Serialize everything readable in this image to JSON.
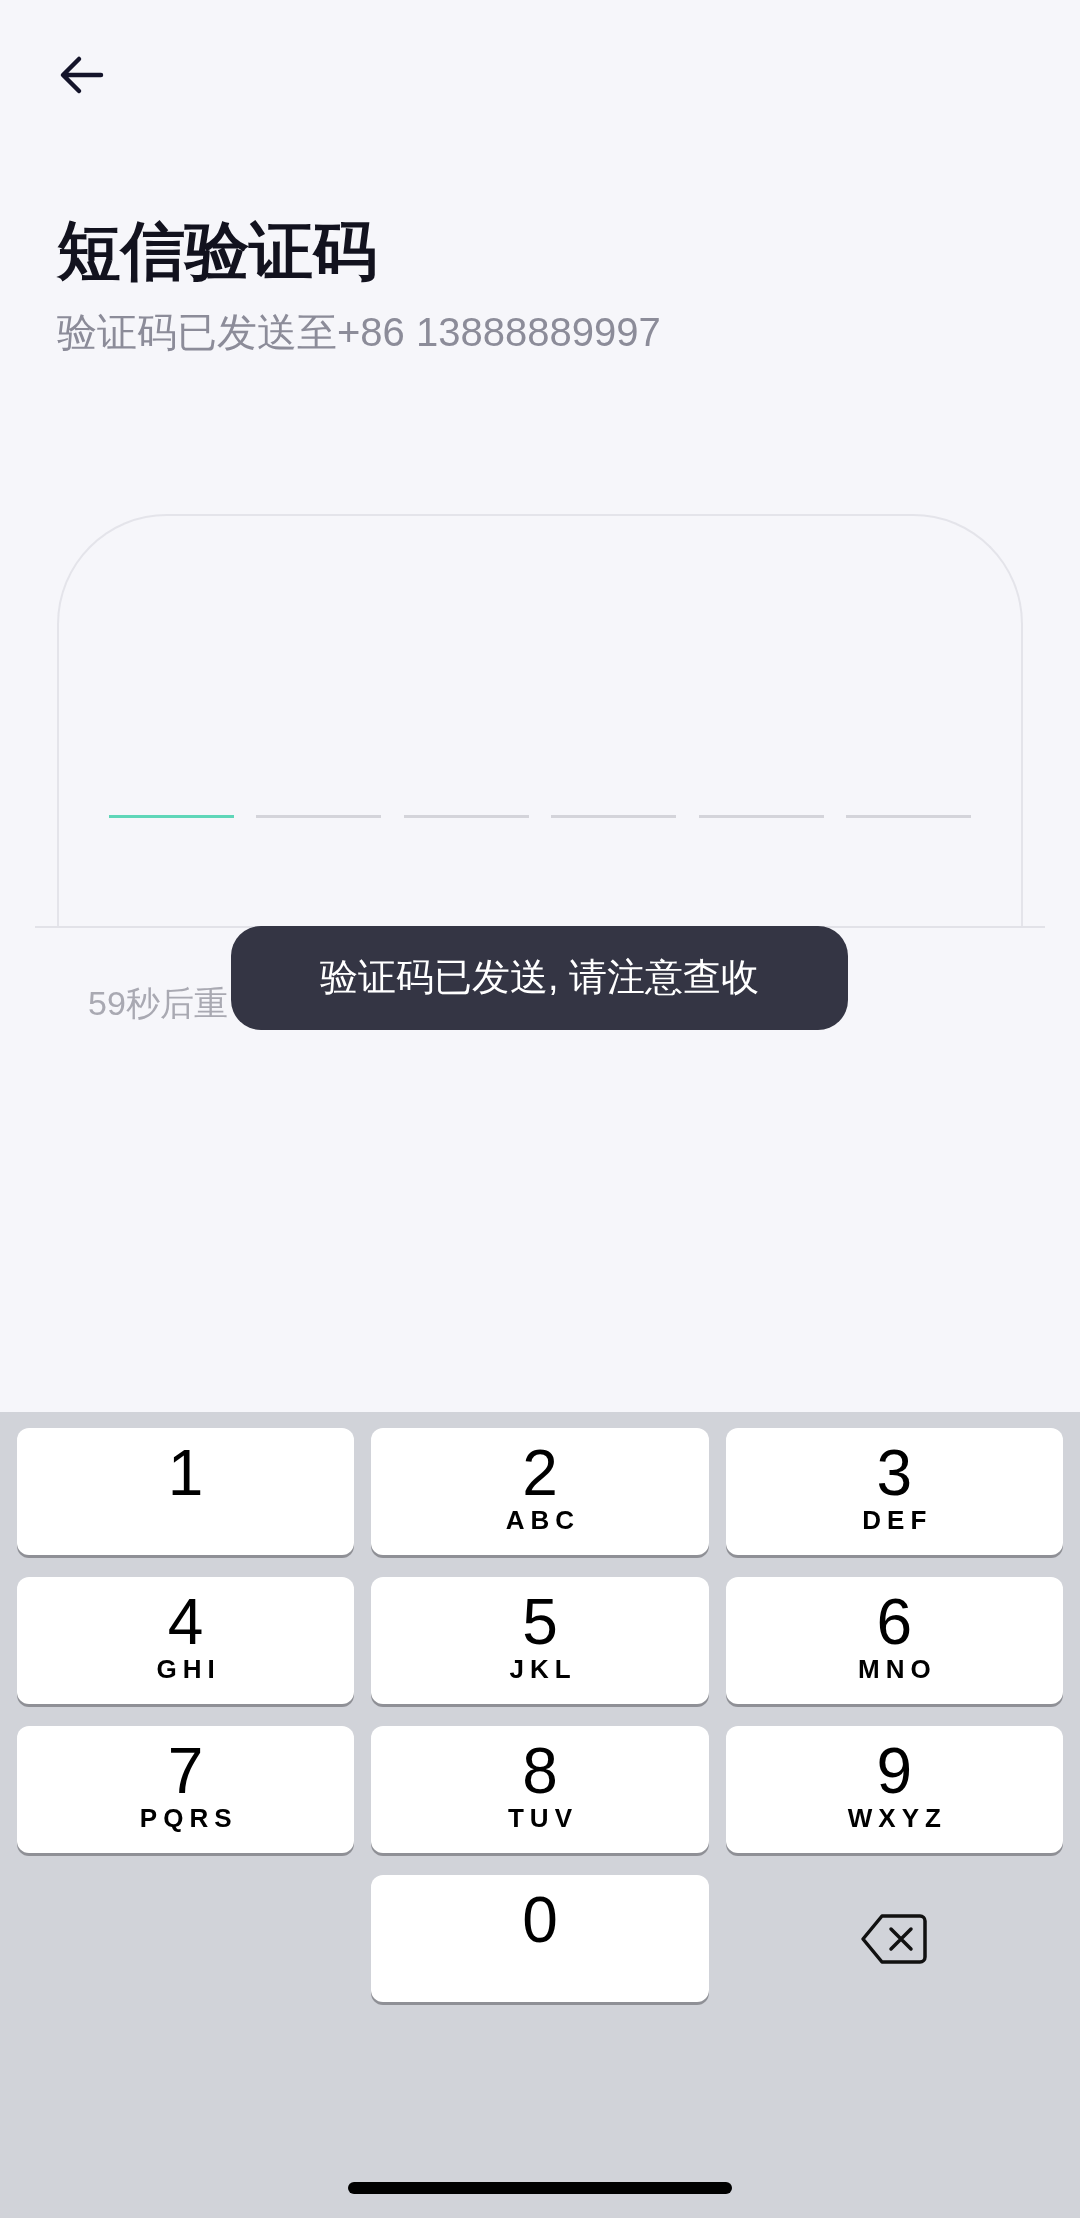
{
  "title": "短信验证码",
  "subtitle": "验证码已发送至+86 13888889997",
  "code_slots": [
    {
      "selected": true
    },
    {
      "selected": false
    },
    {
      "selected": false
    },
    {
      "selected": false
    },
    {
      "selected": false
    },
    {
      "selected": false
    }
  ],
  "countdown": "59秒后重",
  "toast": "验证码已发送, 请注意查收",
  "keypad": [
    {
      "kind": "digit",
      "digit": "1"
    },
    {
      "kind": "digit",
      "digit": "2",
      "letters": "ABC"
    },
    {
      "kind": "digit",
      "digit": "3",
      "letters": "DEF"
    },
    {
      "kind": "digit",
      "digit": "4",
      "letters": "GHI"
    },
    {
      "kind": "digit",
      "digit": "5",
      "letters": "JKL"
    },
    {
      "kind": "digit",
      "digit": "6",
      "letters": "MNO"
    },
    {
      "kind": "digit",
      "digit": "7",
      "letters": "PQRS"
    },
    {
      "kind": "digit",
      "digit": "8",
      "letters": "TUV"
    },
    {
      "kind": "digit",
      "digit": "9",
      "letters": "WXYZ"
    },
    {
      "kind": "spacer"
    },
    {
      "kind": "digit",
      "digit": "0"
    },
    {
      "kind": "delete"
    }
  ]
}
